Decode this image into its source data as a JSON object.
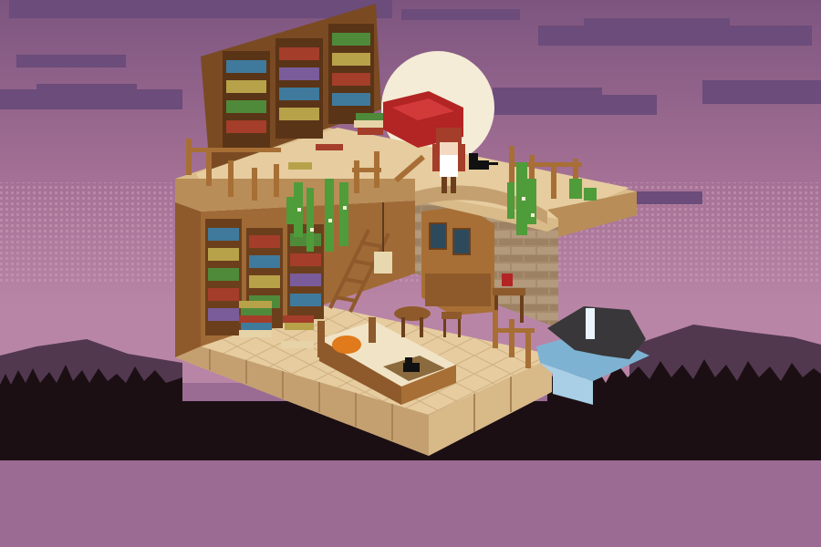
{
  "scene": {
    "kind": "isometric pixel-art library room floating at dusk",
    "palette": {
      "sky_top": "#7c557f",
      "sky_mid": "#a36f94",
      "sky_low": "#b985a6",
      "cloud": "#6b4c7a",
      "moon": "#f4ecd6",
      "mountain": "#51384f",
      "trees": "#1b0f14",
      "ground": "#9b6b94",
      "floor": "#e6cc9f",
      "floor_shade": "#c9a878",
      "wood": "#a76f35",
      "wood_dark": "#6c3f1c",
      "stone": "#a68b6d",
      "water": "#7eb2d2",
      "sofa": "#b32424",
      "leaves": "#4f9c3a"
    }
  }
}
